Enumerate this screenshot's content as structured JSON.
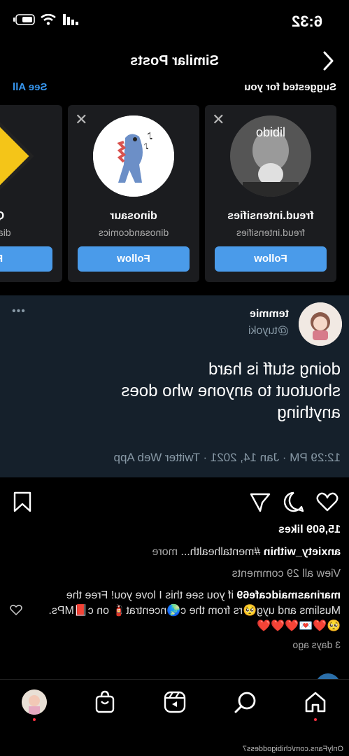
{
  "status_bar": {
    "time": "6:32"
  },
  "header": {
    "title": "Similar Posts"
  },
  "suggested": {
    "title": "Suggested for you",
    "see_all": "See All",
    "cards": [
      {
        "name": "freud.intensifies",
        "handle": "freud.intensifies",
        "follow": "Follow",
        "avatar_text": "libido"
      },
      {
        "name": "dinosaur",
        "handle": "dinosandcomics",
        "follow": "Follow"
      },
      {
        "name": "Qu",
        "handle": "diaryin",
        "follow": "Fo"
      }
    ]
  },
  "tweet": {
    "name": "temmie",
    "handle": "@tuyoki",
    "text_line1": "doing stuff is hard",
    "text_line2": "shoutout to anyone who does",
    "text_line3": "anything",
    "meta": "12:29 PM · Jan 14, 2021 · Twitter Web App"
  },
  "post": {
    "likes": "15,609 likes",
    "caption_user": "anxiety_within",
    "caption_text": "#mentalhealth...",
    "caption_more": "more",
    "view_comments": "View all 29 comments",
    "comment_user": "marinasmaidcafe69",
    "comment_text": "if you see this I love you! Free the Muslims and uyg🥺rs from the c🌏ncentrat🧯 on c📕MPs. 🥺❤️💌❤️❤️❤️",
    "time_ago": "3 days ago"
  },
  "watermark": "OnlyFans.com/chibigoddess7",
  "colors": {
    "follow_blue": "#4a9bea",
    "link_blue": "#3797f0",
    "tweet_bg": "#15202b",
    "card_bg": "#1b1c1f"
  }
}
